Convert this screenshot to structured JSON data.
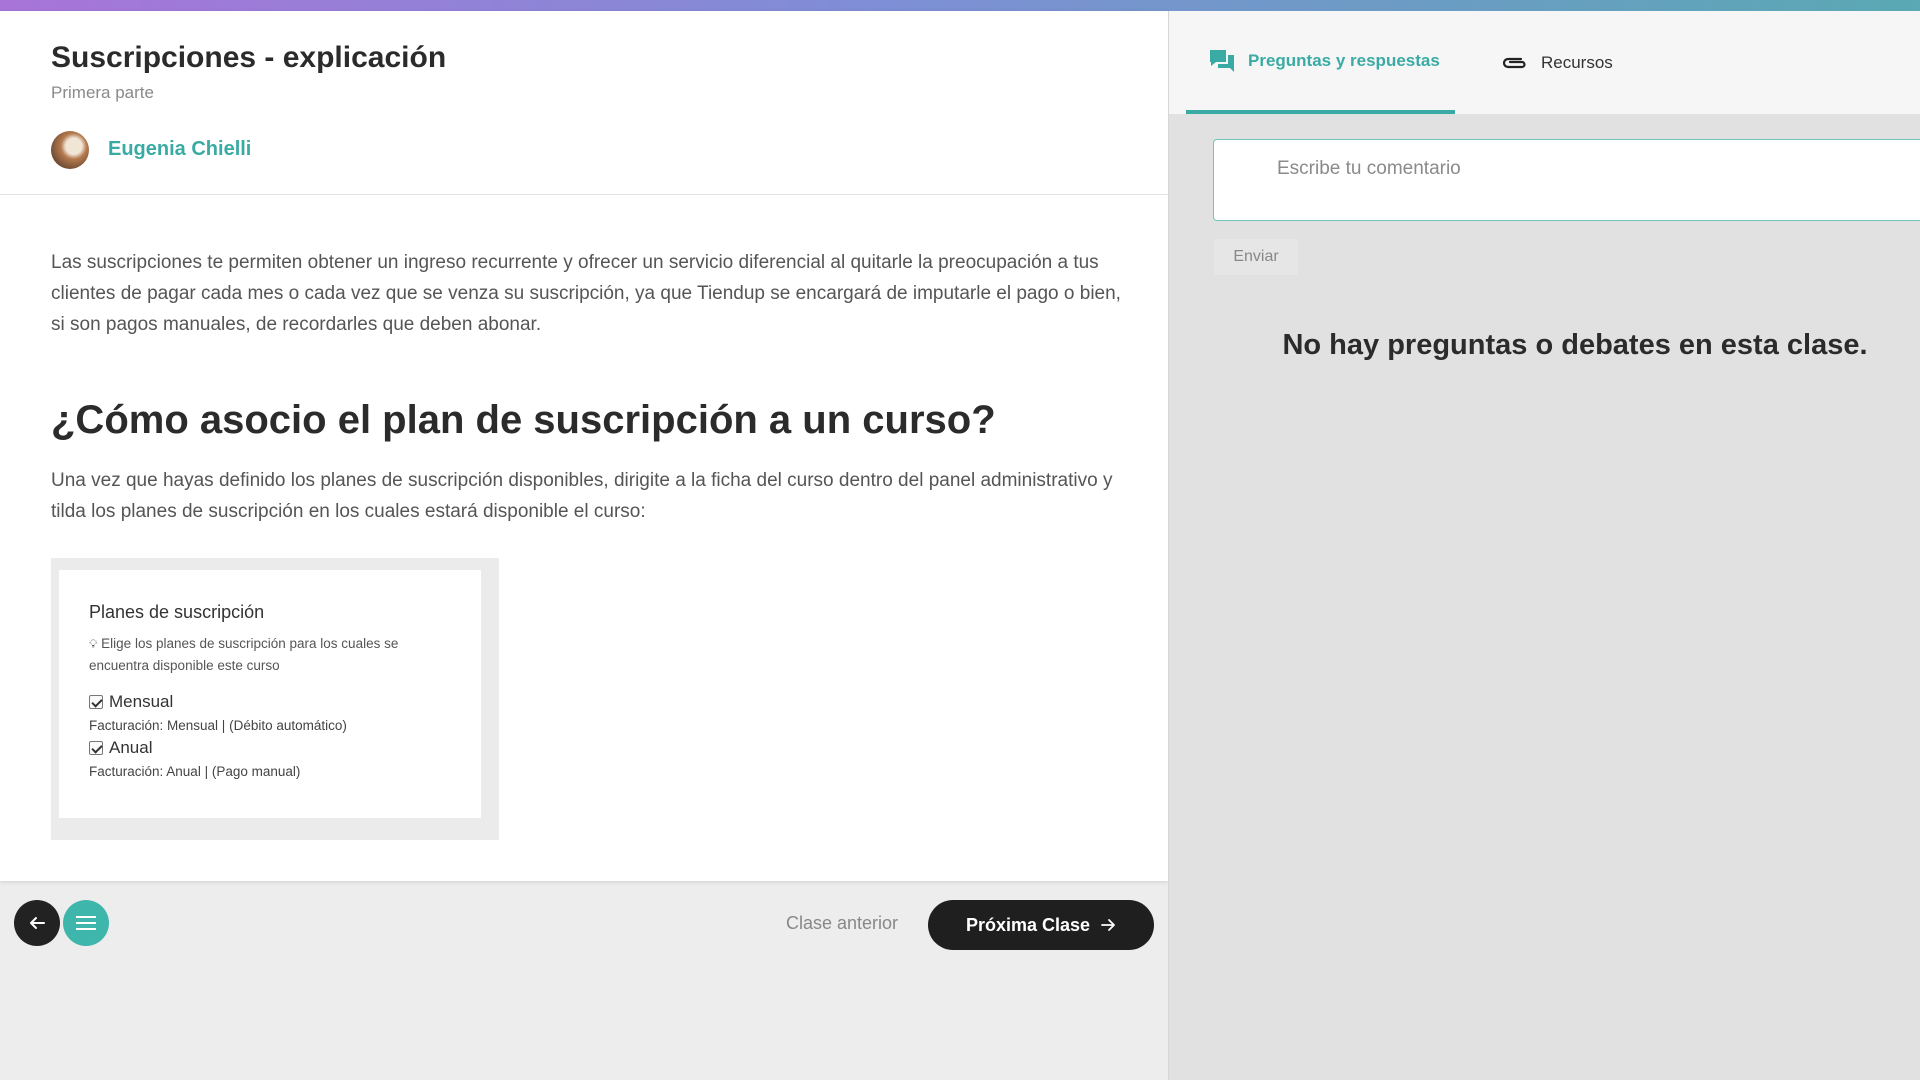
{
  "lesson": {
    "title": "Suscripciones - explicación",
    "subtitle": "Primera parte",
    "author": "Eugenia Chielli",
    "intro": "Las suscripciones te permiten obtener un ingreso recurrente y ofrecer un servicio diferencial al quitarle la preocupación a tus clientes de pagar cada mes o cada vez que se venza su suscripción, ya que Tiendup se encargará de imputarle el pago o bien, si son pagos manuales, de recordarles que deben abonar.",
    "section_heading": "¿Cómo asocio el plan de suscripción a un curso?",
    "section_text": "Una vez que hayas definido los planes de suscripción disponibles, dirigite a la ficha del curso dentro del panel administrativo y tilda los planes de suscripción en los cuales estará disponible el curso:"
  },
  "embed": {
    "title": "Planes de suscripción",
    "hint": "Elige los planes de suscripción para los cuales se encuentra disponible este curso",
    "options": [
      {
        "label": "Mensual",
        "billing": "Facturación: Mensual | (Débito automático)",
        "checked": true
      },
      {
        "label": "Anual",
        "billing": "Facturación: Anual | (Pago manual)",
        "checked": true
      }
    ]
  },
  "nav": {
    "prev_label": "Clase anterior",
    "next_label": "Próxima Clase",
    "back_icon": "arrow-left-icon",
    "menu_icon": "hamburger-menu-icon"
  },
  "sidebar": {
    "tabs": [
      {
        "label": "Preguntas y respuestas",
        "icon": "chat-bubbles-icon",
        "active": true
      },
      {
        "label": "Recursos",
        "icon": "paperclip-icon",
        "active": false
      }
    ],
    "comment_placeholder": "Escribe tu comentario",
    "send_label": "Enviar",
    "empty_message": "No hay preguntas o debates en esta clase."
  },
  "colors": {
    "accent": "#3aaba4",
    "dark_button": "#1f1f1f",
    "menu_button": "#3fb6ac"
  }
}
